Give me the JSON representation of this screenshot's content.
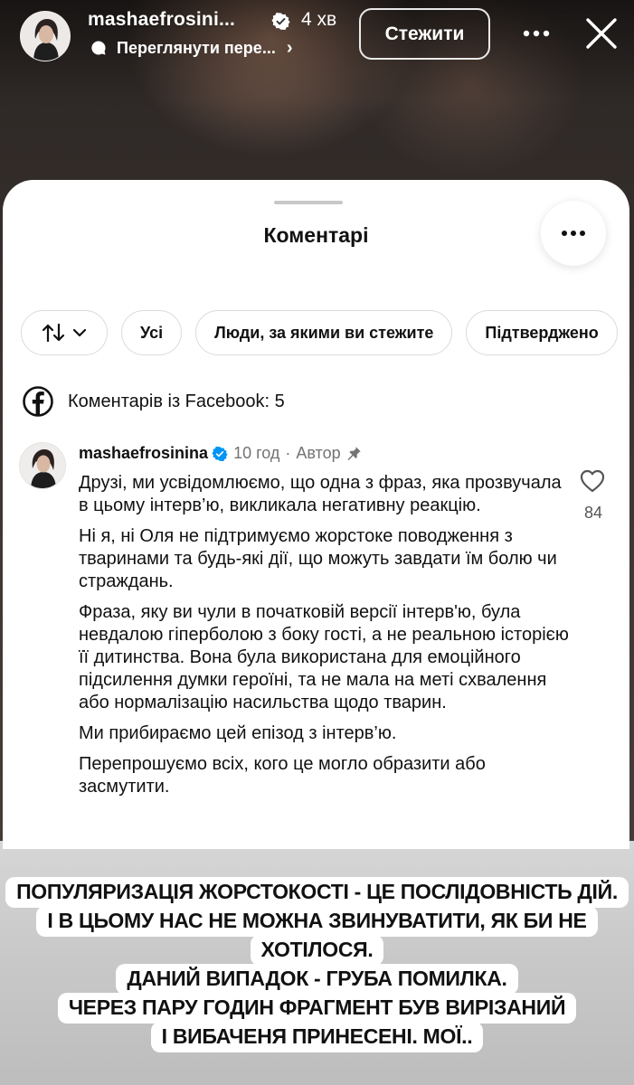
{
  "story": {
    "username": "mashaefrosini...",
    "time": "4 хв",
    "subtitle": "Переглянути пере...",
    "follow_label": "Стежити"
  },
  "sheet": {
    "title": "Коментарі",
    "filters": [
      "Усі",
      "Люди, за якими ви стежите",
      "Підтверджено"
    ],
    "facebook_comments_label": "Коментарів із Facebook: 5"
  },
  "comment": {
    "username": "mashaefrosinina",
    "time": "10 год",
    "separator": "·",
    "author_label": "Автор",
    "likes": "84",
    "paragraphs": [
      "Друзі, ми усвідомлюємо, що одна з фраз, яка прозвучала в цьому інтерв’ю, викликала негативну реакцію.",
      "Ні я, ні Оля не підтримуємо жорстоке поводження з тваринами та будь-які дії, що можуть завдати їм болю чи страждань.",
      "Фраза, яку ви чули в початковій версії інтерв'ю, була невдалою гіперболою з боку гості, а не реальною історією її дитинства. Вона була використана для емоційного підсилення думки героїні, та не мала на меті схвалення або нормалізацію насильства щодо тварин.",
      "Ми прибираємо цей епізод з інтерв’ю.",
      "Перепрошуємо всіх, кого це могло образити або засмутити."
    ]
  },
  "caption": {
    "lines": [
      "ПОПУЛЯРИЗАЦІЯ ЖОРСТОКОСТІ - ЦЕ ПОСЛІДОВНІСТЬ ДІЙ.",
      "І В ЦЬОМУ НАС НЕ МОЖНА ЗВИНУВАТИТИ, ЯК БИ НЕ",
      "ХОТІЛОСЯ.",
      "ДАНИЙ ВИПАДОК - ГРУБА ПОМИЛКА.",
      "ЧЕРЕЗ ПАРУ ГОДИН ФРАГМЕНТ БУВ ВИРІЗАНИЙ",
      "І ВИБАЧЕНЯ ПРИНЕСЕНІ. МОЇ.."
    ]
  },
  "colors": {
    "verified_blue": "#0095f6",
    "facebook_black": "#111111",
    "sheet_bg": "#ffffff",
    "muted_text": "#737373"
  },
  "icons": {
    "sort": "sort-arrows-icon",
    "chevron": "chevron-down-icon",
    "facebook": "facebook-icon",
    "like": "heart-icon",
    "pin": "pin-icon",
    "verified": "verified-badge-icon",
    "close": "close-icon",
    "more": "more-dots-icon"
  }
}
